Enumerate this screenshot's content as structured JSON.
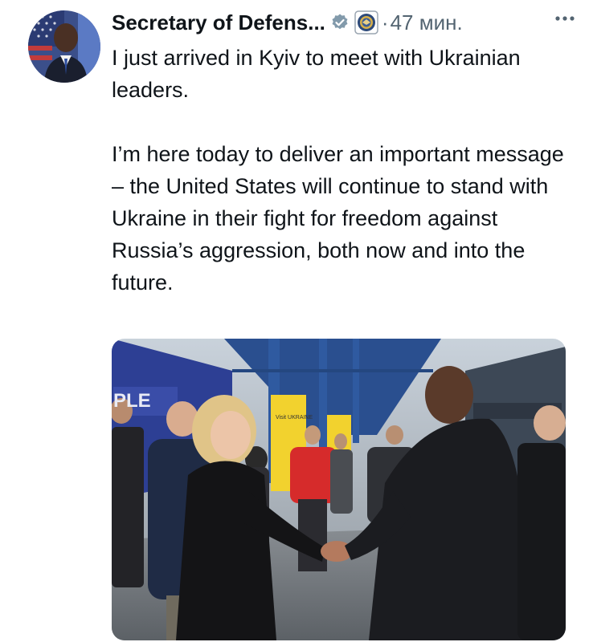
{
  "tweet": {
    "author_name": "Secretary of Defens...",
    "separator": "·",
    "timestamp": "47 мин.",
    "text": "I just arrived in Kyiv to meet with Ukrainian leaders.\n\nI’m here today to deliver an important message – the United States will continue to stand with Ukraine in their fight for freedom against Russia’s aggression, both now and into the future.",
    "media": {
      "sign_text": "PLE",
      "poster_text": "Visit UKRAINE"
    }
  },
  "icons": {
    "verified": "verified-badge-icon",
    "affiliate": "department-seal-icon",
    "more": "more-options-icon"
  },
  "colors": {
    "verified_badge": "#829aab",
    "text_primary": "#0f1419",
    "text_secondary": "#536471"
  }
}
